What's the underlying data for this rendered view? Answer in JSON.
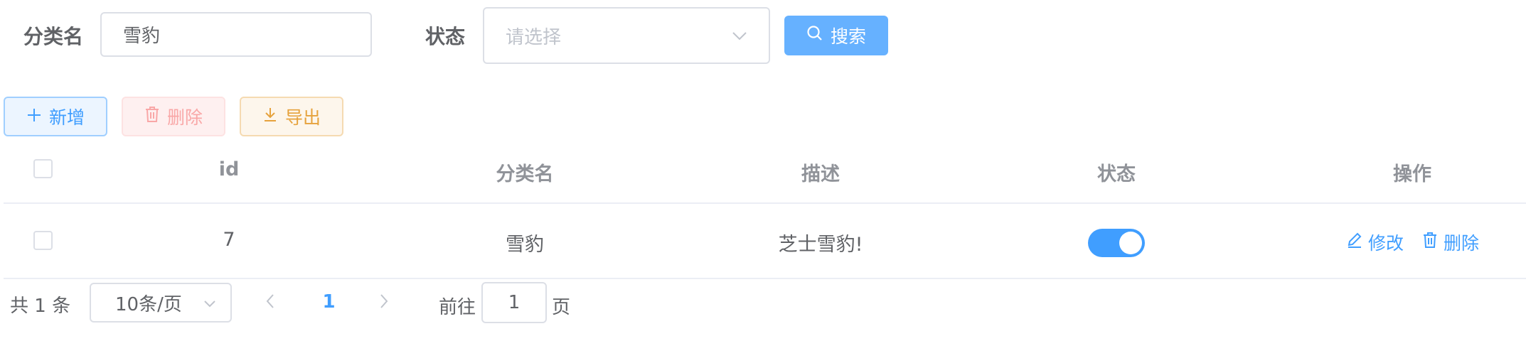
{
  "search_form": {
    "category_label": "分类名",
    "category_value": "雪豹",
    "status_label": "状态",
    "status_placeholder": "请选择",
    "search_button": "搜索"
  },
  "toolbar": {
    "add_label": "新增",
    "delete_label": "删除",
    "export_label": "导出"
  },
  "table": {
    "headers": {
      "id": "id",
      "category": "分类名",
      "description": "描述",
      "status": "状态",
      "actions": "操作"
    },
    "rows": [
      {
        "id": "7",
        "category": "雪豹",
        "description": "芝士雪豹!",
        "status_on": true,
        "edit_label": "修改",
        "delete_label": "删除"
      }
    ]
  },
  "pagination": {
    "total_text": "共 1 条",
    "page_size": "10条/页",
    "current_page": "1",
    "goto_label": "前往",
    "goto_value": "1",
    "page_suffix": "页"
  },
  "colors": {
    "primary": "#409eff",
    "danger": "#f56c6c",
    "warning": "#e6a23c"
  }
}
